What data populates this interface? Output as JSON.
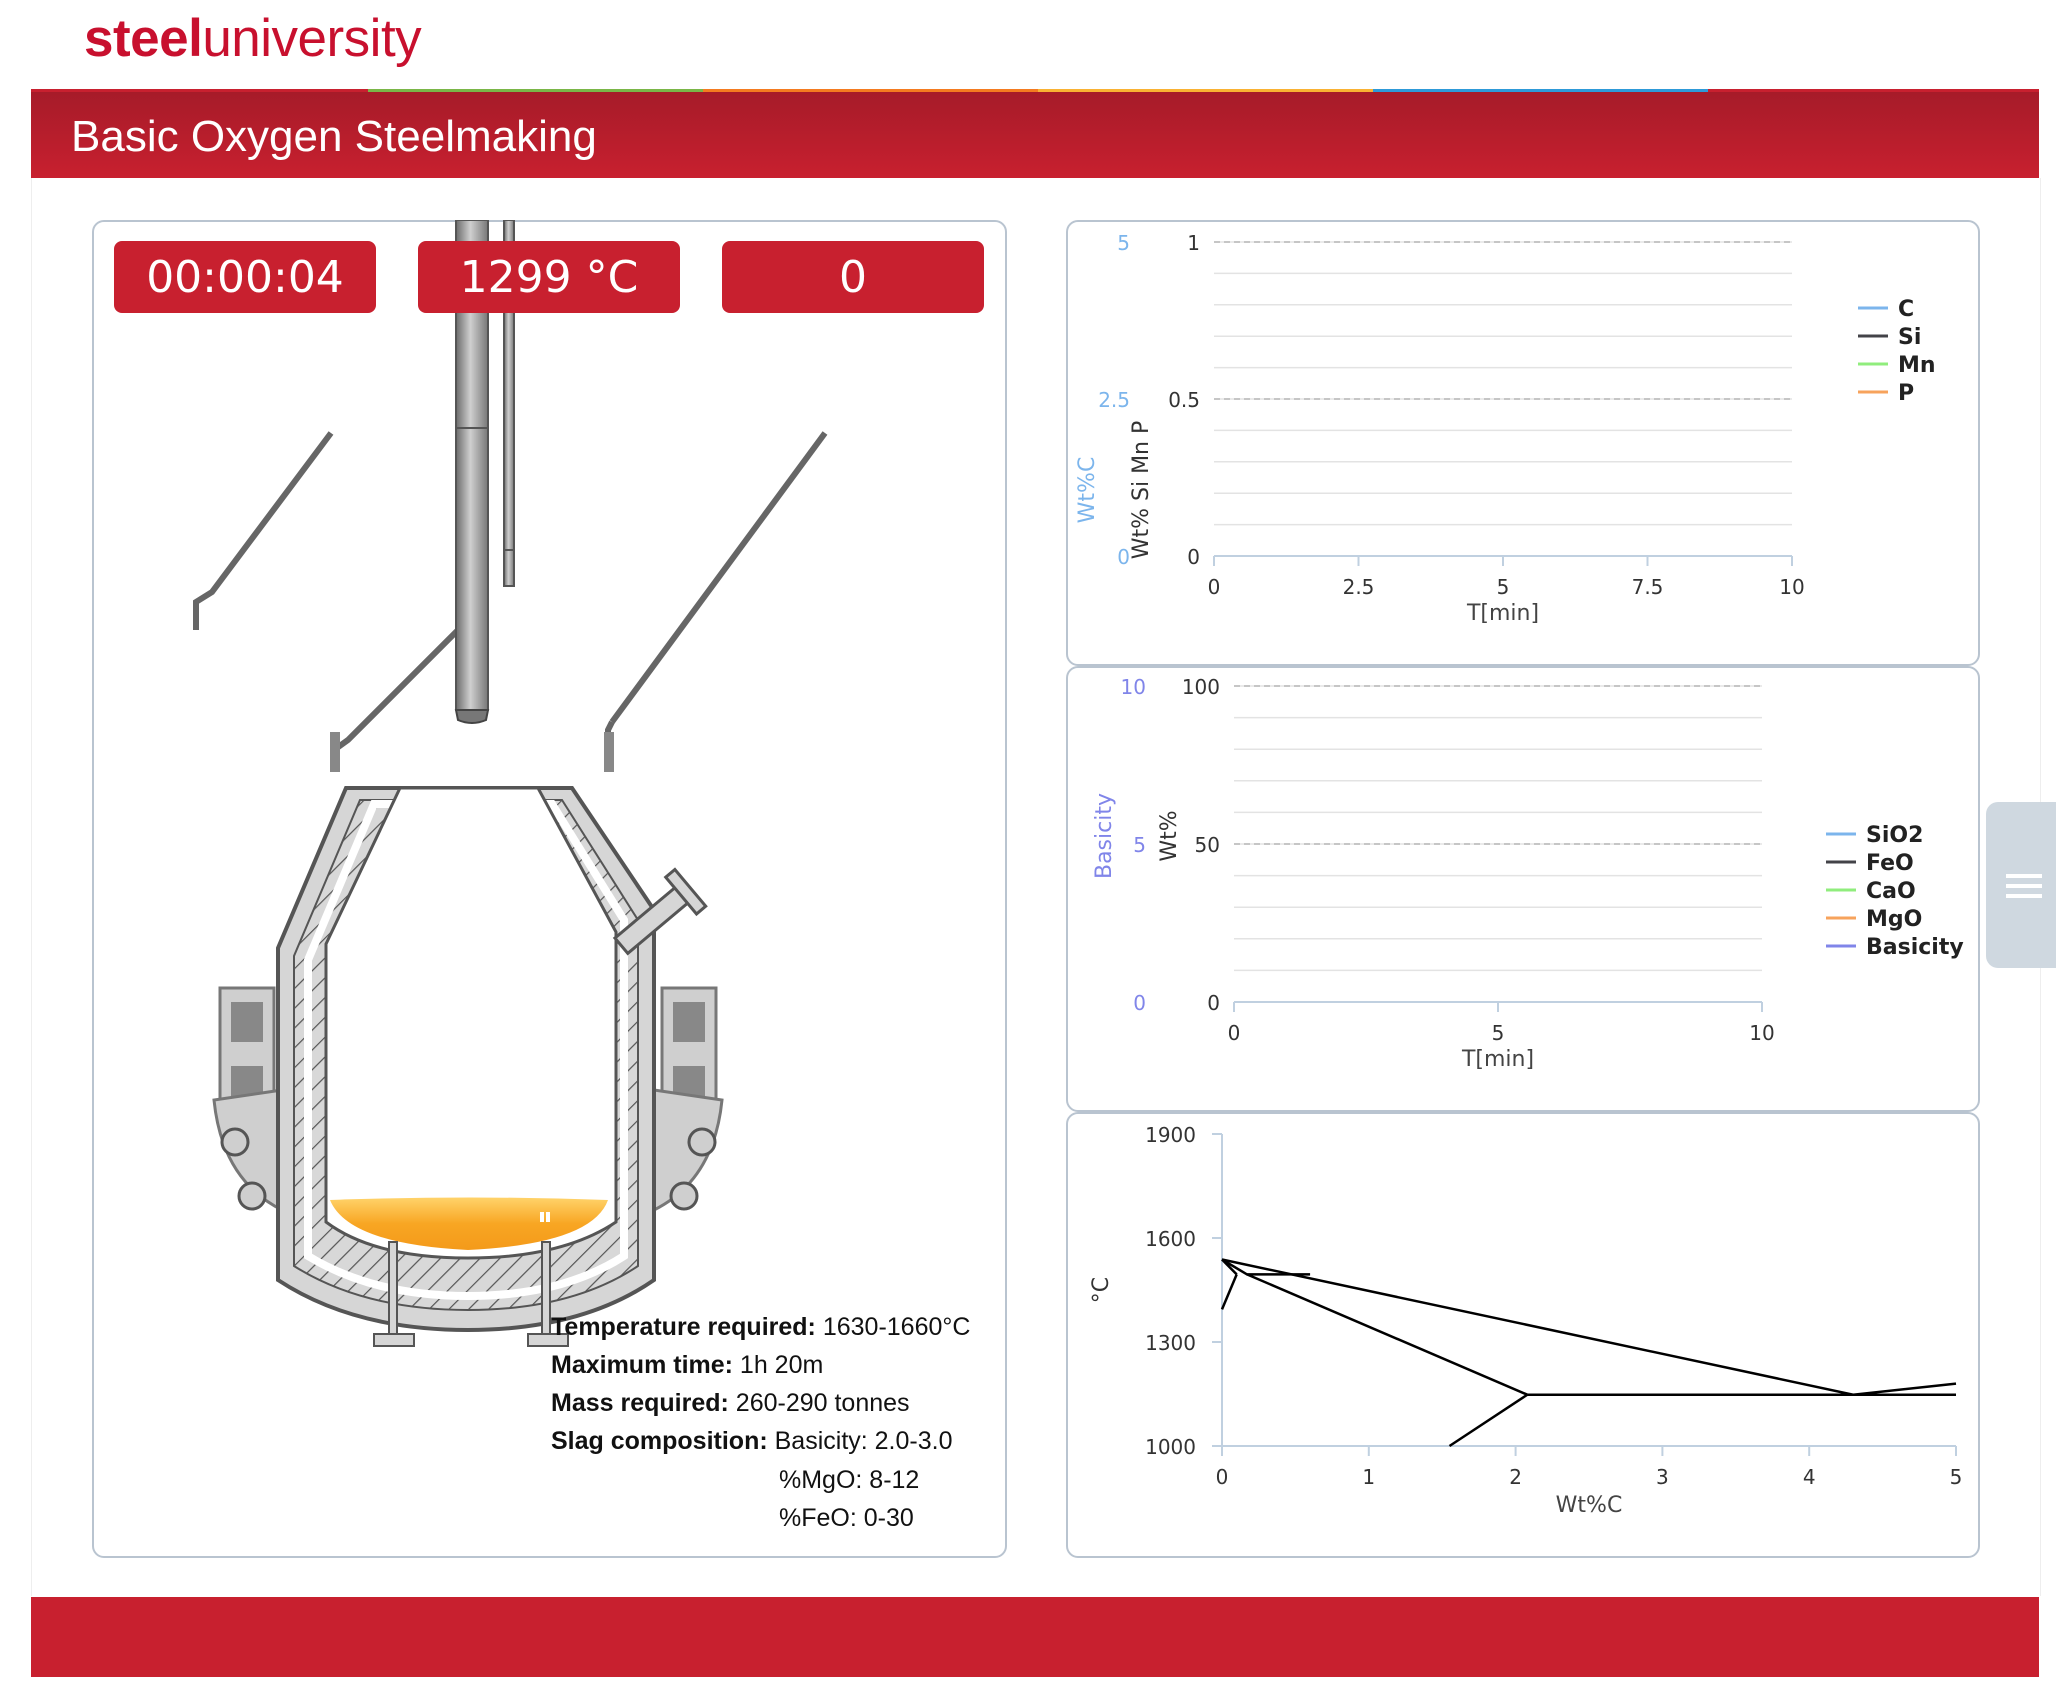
{
  "brand": {
    "bold": "steel",
    "light": "university"
  },
  "header": {
    "title": "Basic Oxygen Steelmaking"
  },
  "counters": {
    "time": "00:00:04",
    "temperature": "1299 °C",
    "score": "0"
  },
  "requirements": {
    "temperature": {
      "label": "Temperature required:",
      "value": " 1630-1660°C"
    },
    "max_time": {
      "label": "Maximum time:",
      "value": " 1h 20m"
    },
    "mass": {
      "label": "Mass required:",
      "value": " 260-290 tonnes"
    },
    "slag": {
      "label": "Slag composition:",
      "value": " Basicity: 2.0-3.0"
    },
    "mgo": "%MgO: 8-12",
    "feo": "%FeO: 0-30"
  },
  "colors": {
    "brand_red": "#c8202f",
    "stripe": [
      "#c8202f",
      "#7ab648",
      "#f47b20",
      "#f9b233",
      "#2e9ad8",
      "#c8202f"
    ],
    "molten": "#f8a623"
  },
  "icons": [
    "converter-vessel-icon",
    "oxygen-lance-icon",
    "menu-icon"
  ],
  "chart_data": [
    {
      "type": "line",
      "xlabel": "T[min]",
      "ylabel": "Wt% Si Mn P",
      "y2label": "Wt%C",
      "xlim": [
        0,
        10
      ],
      "ylim": [
        0,
        1
      ],
      "y2lim": [
        0,
        5
      ],
      "xticks": [
        "0",
        "2.5",
        "5",
        "7.5",
        "10"
      ],
      "yticks": [
        "0",
        "0.5",
        "1"
      ],
      "y2ticks": [
        "0",
        "2.5",
        "5"
      ],
      "grid": true,
      "legend_position": "right",
      "series": [
        {
          "name": "C",
          "color": "#7cb5ec",
          "values": []
        },
        {
          "name": "Si",
          "color": "#434348",
          "values": []
        },
        {
          "name": "Mn",
          "color": "#90ed7d",
          "values": []
        },
        {
          "name": "P",
          "color": "#f7a35c",
          "values": []
        }
      ]
    },
    {
      "type": "line",
      "xlabel": "T[min]",
      "ylabel": "Wt%",
      "y2label": "Basicity",
      "xlim": [
        0,
        10
      ],
      "ylim": [
        0,
        100
      ],
      "y2lim": [
        0,
        10
      ],
      "xticks": [
        "0",
        "5",
        "10"
      ],
      "yticks": [
        "0",
        "50",
        "100"
      ],
      "y2ticks": [
        "0",
        "5",
        "10"
      ],
      "grid": true,
      "legend_position": "right",
      "series": [
        {
          "name": "SiO2",
          "color": "#7cb5ec",
          "values": []
        },
        {
          "name": "FeO",
          "color": "#434348",
          "values": []
        },
        {
          "name": "CaO",
          "color": "#90ed7d",
          "values": []
        },
        {
          "name": "MgO",
          "color": "#f7a35c",
          "values": []
        },
        {
          "name": "Basicity",
          "color": "#8085e9",
          "values": []
        }
      ]
    },
    {
      "type": "line",
      "xlabel": "Wt%C",
      "ylabel": "°C",
      "xlim": [
        0,
        5
      ],
      "ylim": [
        1000,
        1900
      ],
      "xticks": [
        "0",
        "1",
        "2",
        "3",
        "4",
        "5"
      ],
      "yticks": [
        "1000",
        "1300",
        "1600",
        "1900"
      ],
      "grid": false,
      "series": [
        {
          "points": [
            [
              0,
              1538
            ],
            [
              0.17,
              1495
            ],
            [
              0.6,
              1495
            ]
          ]
        },
        {
          "points": [
            [
              0,
              1538
            ],
            [
              0.1,
              1495
            ]
          ]
        },
        {
          "points": [
            [
              0,
              1394
            ],
            [
              0.1,
              1495
            ]
          ]
        },
        {
          "points": [
            [
              0,
              1538
            ],
            [
              4.3,
              1148
            ],
            [
              5,
              1180
            ]
          ]
        },
        {
          "points": [
            [
              0.17,
              1495
            ],
            [
              2.08,
              1148
            ]
          ]
        },
        {
          "points": [
            [
              2.08,
              1148
            ],
            [
              5,
              1148
            ]
          ]
        },
        {
          "points": [
            [
              1.55,
              1000
            ],
            [
              2.08,
              1148
            ]
          ]
        }
      ]
    }
  ]
}
